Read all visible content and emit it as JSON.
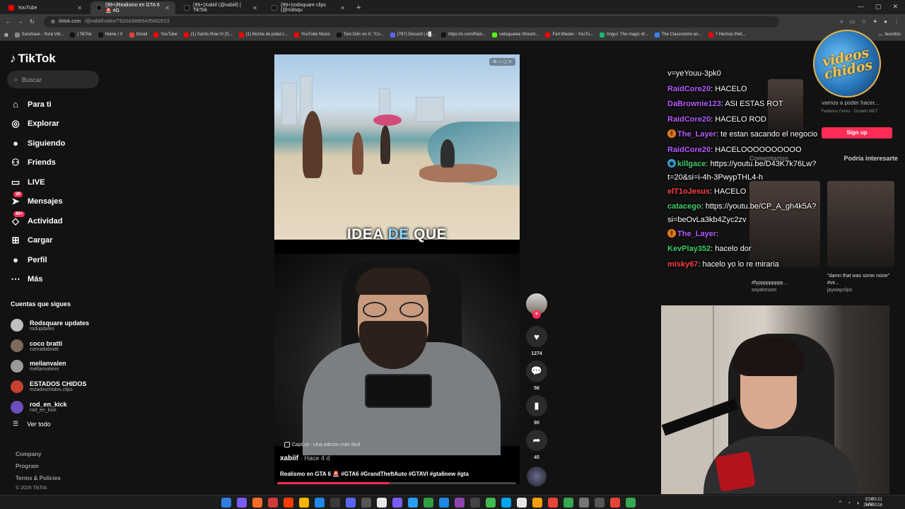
{
  "browser": {
    "tabs": [
      {
        "label": "YouTube",
        "color": "#ff0000"
      },
      {
        "label": "(99+)Realismo en GTA 6 🚨 #G",
        "color": "#2b2b2b"
      },
      {
        "label": "(99+)Xabiif (@xabiif) | TikTok",
        "color": "#2b2b2b"
      },
      {
        "label": "(99+)rodsquare clips (@rodsqu",
        "color": "#2b2b2b"
      }
    ],
    "url_host": "tiktok.com",
    "url_path": "/@xabiif/video/7620438883435662623",
    "bookmarks": [
      {
        "label": "SoraSave - Sora Vid...",
        "color": "#888888"
      },
      {
        "label": "| TikTok",
        "color": "#111111"
      },
      {
        "label": "Home / X",
        "color": "#111111"
      },
      {
        "label": "Gmail",
        "color": "#ea4335"
      },
      {
        "label": "YouTube",
        "color": "#ff0000"
      },
      {
        "label": "(1) Saints Row IV [S...",
        "color": "#ff0000"
      },
      {
        "label": "(1) Noche de jodas t...",
        "color": "#ff0000"
      },
      {
        "label": "YouTube Music",
        "color": "#ff0000"
      },
      {
        "label": "Tom Dörr on X: \"Co...",
        "color": "#111111"
      },
      {
        "label": "(787) Discord | #█...",
        "color": "#5865f2"
      },
      {
        "label": "https://x.com/Rain...",
        "color": "#111111"
      },
      {
        "label": "rodsquaree Stream...",
        "color": "#53fc18"
      },
      {
        "label": "Fart Master - YouTu...",
        "color": "#ff0000"
      },
      {
        "label": "Imgur: The magic of...",
        "color": "#1bb76e"
      },
      {
        "label": "The Classrooms en...",
        "color": "#3b82f6"
      },
      {
        "label": "7 Hechos Pert...",
        "color": "#ff0000"
      }
    ],
    "bookmarks_end": "favoritos"
  },
  "sidebar": {
    "logo": "TikTok",
    "search_placeholder": "Buscar",
    "nav": [
      {
        "label": "Para ti",
        "icon": "⌂",
        "badge": ""
      },
      {
        "label": "Explorar",
        "icon": "◎",
        "badge": ""
      },
      {
        "label": "Siguiendo",
        "icon": "●",
        "badge": ""
      },
      {
        "label": "Friends",
        "icon": "⚇",
        "badge": ""
      },
      {
        "label": "LIVE",
        "icon": "▭",
        "badge": ""
      },
      {
        "label": "Mensajes",
        "icon": "➤",
        "badge": "38"
      },
      {
        "label": "Actividad",
        "icon": "◇",
        "badge": "99+"
      },
      {
        "label": "Cargar",
        "icon": "⊞",
        "badge": ""
      },
      {
        "label": "Perfil",
        "icon": "●",
        "badge": ""
      },
      {
        "label": "Más",
        "icon": "⋯",
        "badge": ""
      }
    ],
    "following_title": "Cuentas que sigues",
    "following": [
      {
        "name": "Rodsquare updates",
        "handle": "rodupdates",
        "color": "#bfbfbf"
      },
      {
        "name": "coco bratti",
        "handle": "conradobratti",
        "color": "#7d6a5a"
      },
      {
        "name": "mellanvalen",
        "handle": "mellanvalenn",
        "color": "#9a9a9a"
      },
      {
        "name": "ESTADOS CHIDOS",
        "handle": "estadoschidos.clips",
        "color": "#c8402f"
      },
      {
        "name": "rod_en_kick",
        "handle": "rod_en_kick",
        "color": "#6b4fbf"
      }
    ],
    "see_all": "Ver todo",
    "footer": [
      "Company",
      "Program",
      "Terms & Policies"
    ],
    "copyright": "© 2026 TikTok"
  },
  "video": {
    "caption_word1": "IDEA",
    "caption_word2": "DE",
    "caption_word3": "QUE",
    "capcut": "CapCut · Una edición más fácil",
    "author": "xabiif",
    "posted": "· Hace 4 d",
    "description": "Realismo en GTA 6 🚨 #GTA6 #GrandTheftAuto #GTAVI #gta6new #gta",
    "progress_fraction": 0.47
  },
  "actions": {
    "likes": "1274",
    "comments": "56",
    "saves": "90",
    "shares": "45"
  },
  "panel": {
    "promo_text": "vamos a poder hacer...",
    "promo_author": "Federico Feres - Growth MKT",
    "signup": "Sign up",
    "tab_comments": "Comentarios",
    "tab_suggested": "Podría interesarte",
    "card1_caption": "\"damn that was some noise\" #vir...",
    "card1_user": "jaywayclips",
    "card2_caption": "#fyppppppppp...",
    "card2_user": "soyalonson"
  },
  "stream": {
    "logo_text": "videos chidos",
    "chat": [
      {
        "user": "",
        "color": "#ffffff",
        "text": "v=yeYouu-3pk0",
        "emote": ""
      },
      {
        "user": "RaidCore20",
        "color": "#b65cff",
        "text": "HACELO",
        "emote": ""
      },
      {
        "user": "DaBrownie123",
        "color": "#b65cff",
        "text": "ASI ESTAS ROT",
        "emote": ""
      },
      {
        "user": "RaidCore20",
        "color": "#b65cff",
        "text": "HACELO ROD",
        "emote": ""
      },
      {
        "user": "The_Layer",
        "color": "#b65cff",
        "text": "te estan sacando el negocio",
        "emote": "!"
      },
      {
        "user": "RaidCore20",
        "color": "#b65cff",
        "text": "HACELOOOOOOOOOO",
        "emote": ""
      },
      {
        "user": "killgace",
        "color": "#3fd16b",
        "text": "https://youtu.be/D43K7k76Lw?t=20&si=i-4h-3PwypTHL4-h",
        "emote": "●"
      },
      {
        "user": "elT1oJesus",
        "color": "#ff4242",
        "text": "HACELO",
        "emote": ""
      },
      {
        "user": "catacego",
        "color": "#3fd16b",
        "text": "https://youtu.be/CP_A_gh4k5A?si=beOvLa3kb4Zyc2zv",
        "emote": ""
      },
      {
        "user": "The_Layer",
        "color": "#b65cff",
        "text": "",
        "emote": "!"
      },
      {
        "user": "KevPlay352",
        "color": "#3fd16b",
        "text": "hacelo dor",
        "emote": ""
      },
      {
        "user": "misky67",
        "color": "#ff4242",
        "text": "hacelo yo lo re miraria",
        "emote": ""
      }
    ]
  },
  "taskbar": {
    "lang1": "ESP",
    "lang2": "LAA",
    "time": "03:21",
    "date": "28/3/2026"
  }
}
